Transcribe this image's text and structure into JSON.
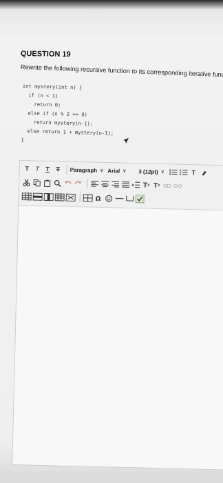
{
  "question": {
    "title": "QUESTION 19",
    "instruction": "Rewrite the following recursive function to its corresponding iterative function."
  },
  "code_lines": [
    "int mystery(int n) {",
    "  if (n < 1)",
    "    return 0;",
    "  else if (n % 2 == 0)",
    "    return mystery(n-1);",
    "  else return 1 + mystery(n-1);",
    "}"
  ],
  "toolbar": {
    "bold": "T",
    "italic": "T",
    "underline": "T",
    "strikethrough": "T",
    "paragraph_select": "Paragraph",
    "font_select": "Arial",
    "size_select": "3 (12pt)",
    "superscript": "T",
    "subscript": "T",
    "superscript_mark": "x",
    "subscript_mark": "x",
    "text_color_label": "T",
    "chevron": "∨"
  },
  "colors": {
    "accent_icon": "#3a3a3a",
    "faded_icon": "#c46a5a"
  }
}
